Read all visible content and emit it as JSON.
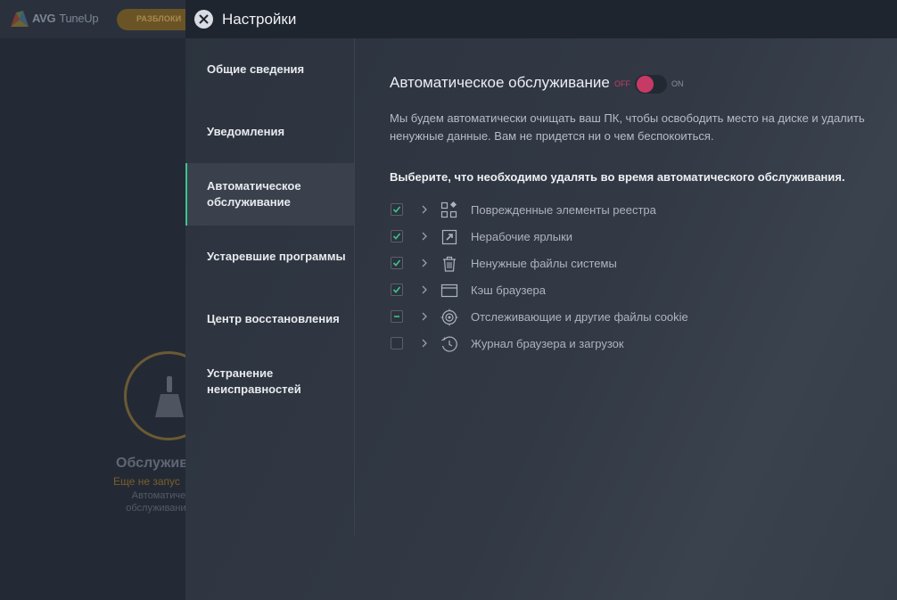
{
  "background_app": {
    "logo_text": "AVG",
    "product_text": "TuneUp",
    "unlock_button": "РАЗБЛОКИ",
    "status_title": "Обслужив",
    "status_sub": "Еще не запус",
    "status_desc": "Автоматиче обслуживание"
  },
  "header": {
    "title": "Настройки",
    "close_icon": "close-icon"
  },
  "nav": {
    "items": [
      {
        "label": "Общие сведения",
        "active": false
      },
      {
        "label": "Уведомления",
        "active": false
      },
      {
        "label": "Автоматическое обслуживание",
        "active": true
      },
      {
        "label": "Устаревшие программы",
        "active": false
      },
      {
        "label": "Центр восстановления",
        "active": false
      },
      {
        "label": "Устранение неисправностей",
        "active": false
      }
    ]
  },
  "main": {
    "heading": "Автоматическое обслуживание",
    "toggle": {
      "off_label": "OFF",
      "on_label": "ON",
      "state": "off"
    },
    "description": "Мы будем автоматически очищать ваш ПК, чтобы освободить место на диске и удалить ненужные данные. Вам не придется ни о чем беспокоиться.",
    "choose_label": "Выберите, что необходимо удалять во время автоматического обслуживания.",
    "items": [
      {
        "label": "Поврежденные элементы реестра",
        "state": "checked",
        "icon": "registry-icon"
      },
      {
        "label": "Нерабочие ярлыки",
        "state": "checked",
        "icon": "shortcut-icon"
      },
      {
        "label": "Ненужные файлы системы",
        "state": "checked",
        "icon": "trash-icon"
      },
      {
        "label": "Кэш браузера",
        "state": "checked",
        "icon": "browser-window-icon"
      },
      {
        "label": "Отслеживающие и другие файлы cookie",
        "state": "indeterminate",
        "icon": "tracking-target-icon"
      },
      {
        "label": "Журнал браузера и загрузок",
        "state": "unchecked",
        "icon": "history-clock-icon"
      }
    ]
  },
  "colors": {
    "accent_green": "#3ec28f",
    "toggle_red": "#c73a66",
    "header_bg": "#1f252f"
  }
}
